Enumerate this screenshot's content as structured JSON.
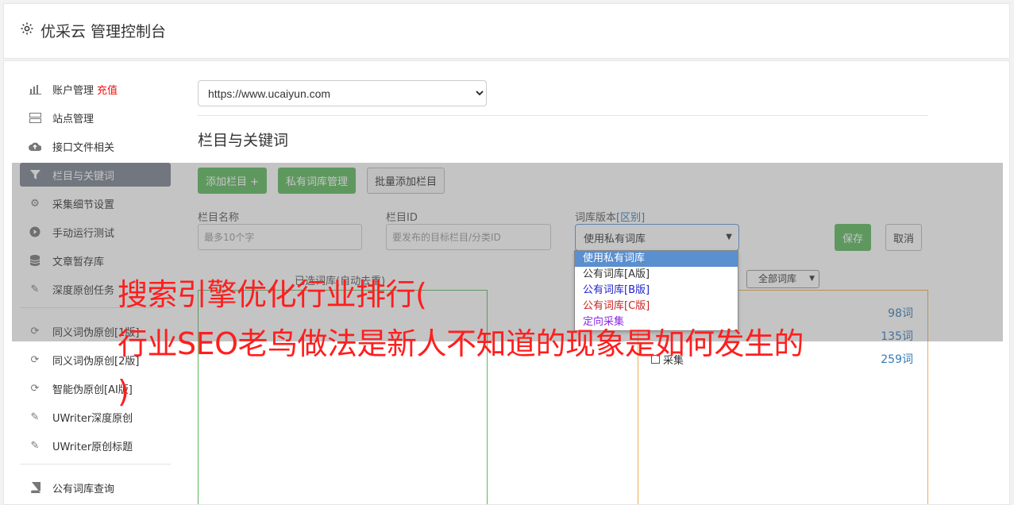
{
  "header": {
    "title": "优采云 管理控制台"
  },
  "sidebar": {
    "account": {
      "label": "账户管理",
      "recharge": "充值"
    },
    "items": [
      {
        "label": "站点管理"
      },
      {
        "label": "接口文件相关"
      },
      {
        "label": "栏目与关键词"
      },
      {
        "label": "采集细节设置"
      },
      {
        "label": "手动运行测试"
      },
      {
        "label": "文章暂存库"
      },
      {
        "label": "深度原创任务"
      },
      {
        "label": "同义词伪原创[1版]"
      },
      {
        "label": "同义词伪原创[2版]"
      },
      {
        "label": "智能伪原创[AI版]"
      },
      {
        "label": "UWriter深度原创"
      },
      {
        "label": "UWriter原创标题"
      },
      {
        "label": "公有词库查询"
      }
    ]
  },
  "main": {
    "site_select": "https://www.ucaiyun.com",
    "section_title": "栏目与关键词",
    "buttons": {
      "add": "添加栏目 +",
      "private_lib": "私有词库管理",
      "batch_add": "批量添加栏目"
    },
    "form": {
      "name_label": "栏目名称",
      "name_placeholder": "最多10个字",
      "id_label": "栏目ID",
      "id_placeholder": "要发布的目标栏目/分类ID",
      "version_label": "词库版本",
      "version_link": "[区别]",
      "version_selected": "使用私有词库",
      "save": "保存",
      "cancel": "取消"
    },
    "dropdown_options": [
      {
        "label": "使用私有词库",
        "color": "#ffffff"
      },
      {
        "label": "公有词库[A版]",
        "color": "#333333"
      },
      {
        "label": "公有词库[B版]",
        "color": "#2222cc"
      },
      {
        "label": "公有词库[C版]",
        "color": "#cc2222"
      },
      {
        "label": "定向采集",
        "color": "#8a2be2"
      }
    ],
    "selected_panel_title": "已选词库(自动去重)",
    "lib_filter": "全部词库",
    "lib_rows": [
      {
        "name": "",
        "count": "98词"
      },
      {
        "name": "",
        "count": "135词"
      },
      {
        "name": "采集",
        "count": "259词"
      }
    ]
  },
  "watermark": {
    "line1": "搜索引擎优化行业排行(",
    "line2": "行业SEO老鸟做法是新人不知道的现象是如何发生的",
    "line3": ")"
  }
}
